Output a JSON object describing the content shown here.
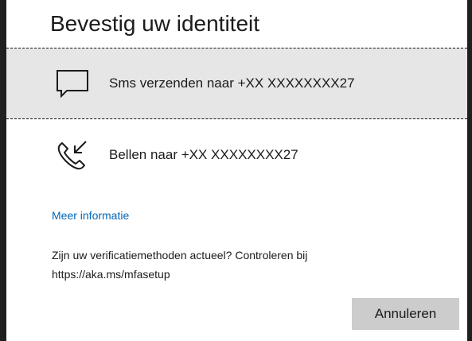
{
  "dialog": {
    "title": "Bevestig uw identiteit",
    "options": [
      {
        "icon": "sms-icon",
        "label": "Sms verzenden naar +XX XXXXXXXX27",
        "selected": true
      },
      {
        "icon": "phone-call-icon",
        "label": "Bellen naar +XX XXXXXXXX27",
        "selected": false
      }
    ],
    "more_info_link": "Meer informatie",
    "info_line1": "Zijn uw verificatiemethoden actueel? Controleren bij",
    "info_line2": "https://aka.ms/mfasetup",
    "cancel_label": "Annuleren"
  },
  "colors": {
    "selected_bg": "#e6e6e6",
    "link": "#0067b8",
    "button_bg": "#cccccc",
    "edge_strip": "#1f1f1f"
  }
}
